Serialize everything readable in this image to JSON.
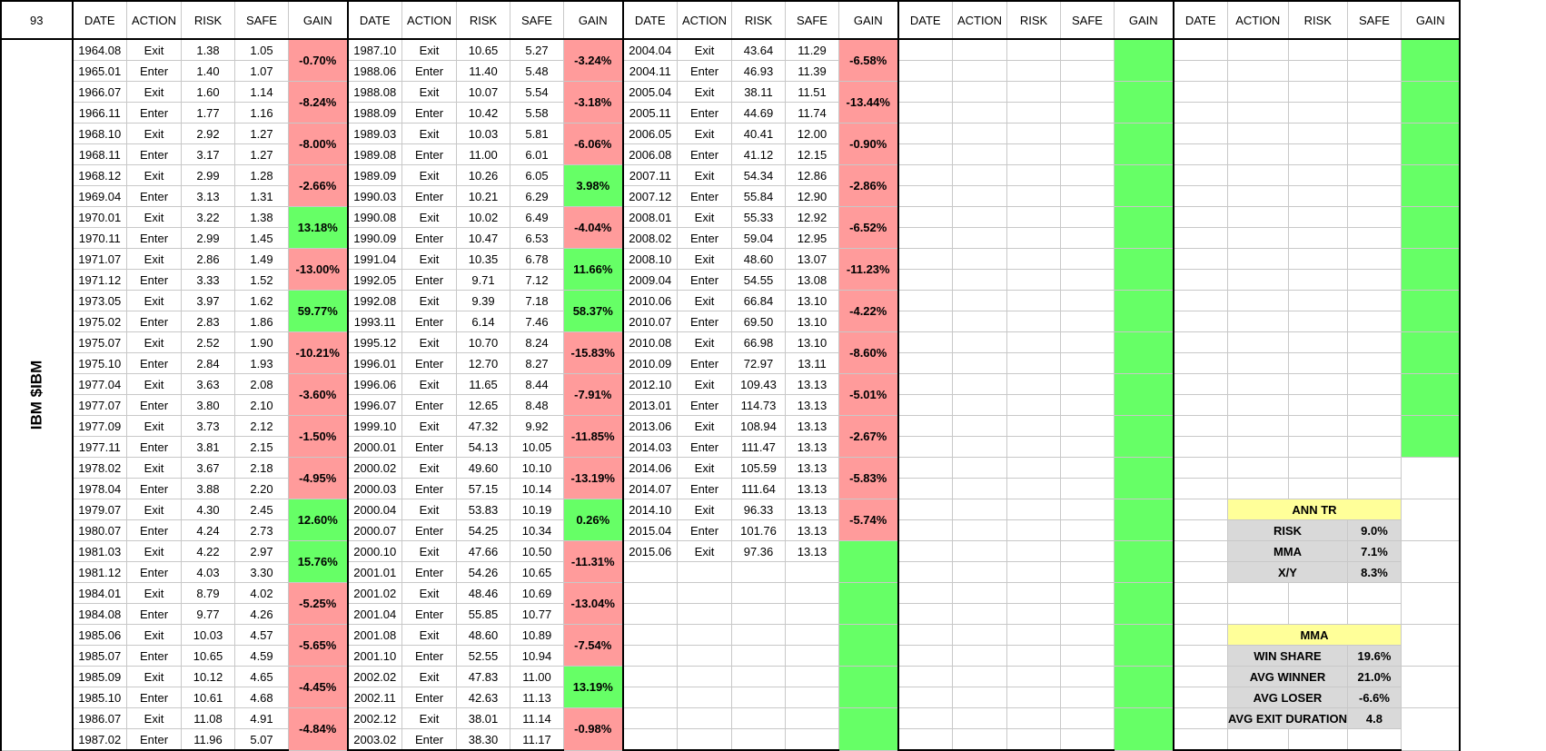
{
  "corner": "93",
  "ticker": "IBM $IBM",
  "headers": [
    "DATE",
    "ACTION",
    "RISK",
    "SAFE",
    "GAIN"
  ],
  "blocks": [
    {
      "rows": [
        [
          "1964.08",
          "Exit",
          "1.38",
          "1.05"
        ],
        [
          "1965.01",
          "Enter",
          "1.40",
          "1.07"
        ],
        [
          "1966.07",
          "Exit",
          "1.60",
          "1.14"
        ],
        [
          "1966.11",
          "Enter",
          "1.77",
          "1.16"
        ],
        [
          "1968.10",
          "Exit",
          "2.92",
          "1.27"
        ],
        [
          "1968.11",
          "Enter",
          "3.17",
          "1.27"
        ],
        [
          "1968.12",
          "Exit",
          "2.99",
          "1.28"
        ],
        [
          "1969.04",
          "Enter",
          "3.13",
          "1.31"
        ],
        [
          "1970.01",
          "Exit",
          "3.22",
          "1.38"
        ],
        [
          "1970.11",
          "Enter",
          "2.99",
          "1.45"
        ],
        [
          "1971.07",
          "Exit",
          "2.86",
          "1.49"
        ],
        [
          "1971.12",
          "Enter",
          "3.33",
          "1.52"
        ],
        [
          "1973.05",
          "Exit",
          "3.97",
          "1.62"
        ],
        [
          "1975.02",
          "Enter",
          "2.83",
          "1.86"
        ],
        [
          "1975.07",
          "Exit",
          "2.52",
          "1.90"
        ],
        [
          "1975.10",
          "Enter",
          "2.84",
          "1.93"
        ],
        [
          "1977.04",
          "Exit",
          "3.63",
          "2.08"
        ],
        [
          "1977.07",
          "Enter",
          "3.80",
          "2.10"
        ],
        [
          "1977.09",
          "Exit",
          "3.73",
          "2.12"
        ],
        [
          "1977.11",
          "Enter",
          "3.81",
          "2.15"
        ],
        [
          "1978.02",
          "Exit",
          "3.67",
          "2.18"
        ],
        [
          "1978.04",
          "Enter",
          "3.88",
          "2.20"
        ],
        [
          "1979.07",
          "Exit",
          "4.30",
          "2.45"
        ],
        [
          "1980.07",
          "Enter",
          "4.24",
          "2.73"
        ],
        [
          "1981.03",
          "Exit",
          "4.22",
          "2.97"
        ],
        [
          "1981.12",
          "Enter",
          "4.03",
          "3.30"
        ],
        [
          "1984.01",
          "Exit",
          "8.79",
          "4.02"
        ],
        [
          "1984.08",
          "Enter",
          "9.77",
          "4.26"
        ],
        [
          "1985.06",
          "Exit",
          "10.03",
          "4.57"
        ],
        [
          "1985.07",
          "Enter",
          "10.65",
          "4.59"
        ],
        [
          "1985.09",
          "Exit",
          "10.12",
          "4.65"
        ],
        [
          "1985.10",
          "Enter",
          "10.61",
          "4.68"
        ],
        [
          "1986.07",
          "Exit",
          "11.08",
          "4.91"
        ],
        [
          "1987.02",
          "Enter",
          "11.96",
          "5.07"
        ]
      ],
      "gains": [
        {
          "v": "-0.70%",
          "c": "red"
        },
        {
          "v": "-8.24%",
          "c": "red"
        },
        {
          "v": "-8.00%",
          "c": "red"
        },
        {
          "v": "-2.66%",
          "c": "red"
        },
        {
          "v": "13.18%",
          "c": "green"
        },
        {
          "v": "-13.00%",
          "c": "red"
        },
        {
          "v": "59.77%",
          "c": "green"
        },
        {
          "v": "-10.21%",
          "c": "red"
        },
        {
          "v": "-3.60%",
          "c": "red"
        },
        {
          "v": "-1.50%",
          "c": "red"
        },
        {
          "v": "-4.95%",
          "c": "red"
        },
        {
          "v": "12.60%",
          "c": "green"
        },
        {
          "v": "15.76%",
          "c": "green"
        },
        {
          "v": "-5.25%",
          "c": "red"
        },
        {
          "v": "-5.65%",
          "c": "red"
        },
        {
          "v": "-4.45%",
          "c": "red"
        },
        {
          "v": "-4.84%",
          "c": "red"
        }
      ]
    },
    {
      "rows": [
        [
          "1987.10",
          "Exit",
          "10.65",
          "5.27"
        ],
        [
          "1988.06",
          "Enter",
          "11.40",
          "5.48"
        ],
        [
          "1988.08",
          "Exit",
          "10.07",
          "5.54"
        ],
        [
          "1988.09",
          "Enter",
          "10.42",
          "5.58"
        ],
        [
          "1989.03",
          "Exit",
          "10.03",
          "5.81"
        ],
        [
          "1989.08",
          "Enter",
          "11.00",
          "6.01"
        ],
        [
          "1989.09",
          "Exit",
          "10.26",
          "6.05"
        ],
        [
          "1990.03",
          "Enter",
          "10.21",
          "6.29"
        ],
        [
          "1990.08",
          "Exit",
          "10.02",
          "6.49"
        ],
        [
          "1990.09",
          "Enter",
          "10.47",
          "6.53"
        ],
        [
          "1991.04",
          "Exit",
          "10.35",
          "6.78"
        ],
        [
          "1992.05",
          "Enter",
          "9.71",
          "7.12"
        ],
        [
          "1992.08",
          "Exit",
          "9.39",
          "7.18"
        ],
        [
          "1993.11",
          "Enter",
          "6.14",
          "7.46"
        ],
        [
          "1995.12",
          "Exit",
          "10.70",
          "8.24"
        ],
        [
          "1996.01",
          "Enter",
          "12.70",
          "8.27"
        ],
        [
          "1996.06",
          "Exit",
          "11.65",
          "8.44"
        ],
        [
          "1996.07",
          "Enter",
          "12.65",
          "8.48"
        ],
        [
          "1999.10",
          "Exit",
          "47.32",
          "9.92"
        ],
        [
          "2000.01",
          "Enter",
          "54.13",
          "10.05"
        ],
        [
          "2000.02",
          "Exit",
          "49.60",
          "10.10"
        ],
        [
          "2000.03",
          "Enter",
          "57.15",
          "10.14"
        ],
        [
          "2000.04",
          "Exit",
          "53.83",
          "10.19"
        ],
        [
          "2000.07",
          "Enter",
          "54.25",
          "10.34"
        ],
        [
          "2000.10",
          "Exit",
          "47.66",
          "10.50"
        ],
        [
          "2001.01",
          "Enter",
          "54.26",
          "10.65"
        ],
        [
          "2001.02",
          "Exit",
          "48.46",
          "10.69"
        ],
        [
          "2001.04",
          "Enter",
          "55.85",
          "10.77"
        ],
        [
          "2001.08",
          "Exit",
          "48.60",
          "10.89"
        ],
        [
          "2001.10",
          "Enter",
          "52.55",
          "10.94"
        ],
        [
          "2002.02",
          "Exit",
          "47.83",
          "11.00"
        ],
        [
          "2002.11",
          "Enter",
          "42.63",
          "11.13"
        ],
        [
          "2002.12",
          "Exit",
          "38.01",
          "11.14"
        ],
        [
          "2003.02",
          "Enter",
          "38.30",
          "11.17"
        ]
      ],
      "gains": [
        {
          "v": "-3.24%",
          "c": "red"
        },
        {
          "v": "-3.18%",
          "c": "red"
        },
        {
          "v": "-6.06%",
          "c": "red"
        },
        {
          "v": "3.98%",
          "c": "green"
        },
        {
          "v": "-4.04%",
          "c": "red"
        },
        {
          "v": "11.66%",
          "c": "green"
        },
        {
          "v": "58.37%",
          "c": "green"
        },
        {
          "v": "-15.83%",
          "c": "red"
        },
        {
          "v": "-7.91%",
          "c": "red"
        },
        {
          "v": "-11.85%",
          "c": "red"
        },
        {
          "v": "-13.19%",
          "c": "red"
        },
        {
          "v": "0.26%",
          "c": "green"
        },
        {
          "v": "-11.31%",
          "c": "red"
        },
        {
          "v": "-13.04%",
          "c": "red"
        },
        {
          "v": "-7.54%",
          "c": "red"
        },
        {
          "v": "13.19%",
          "c": "green"
        },
        {
          "v": "-0.98%",
          "c": "red"
        }
      ]
    },
    {
      "rows": [
        [
          "2004.04",
          "Exit",
          "43.64",
          "11.29"
        ],
        [
          "2004.11",
          "Enter",
          "46.93",
          "11.39"
        ],
        [
          "2005.04",
          "Exit",
          "38.11",
          "11.51"
        ],
        [
          "2005.11",
          "Enter",
          "44.69",
          "11.74"
        ],
        [
          "2006.05",
          "Exit",
          "40.41",
          "12.00"
        ],
        [
          "2006.08",
          "Enter",
          "41.12",
          "12.15"
        ],
        [
          "2007.11",
          "Exit",
          "54.34",
          "12.86"
        ],
        [
          "2007.12",
          "Enter",
          "55.84",
          "12.90"
        ],
        [
          "2008.01",
          "Exit",
          "55.33",
          "12.92"
        ],
        [
          "2008.02",
          "Enter",
          "59.04",
          "12.95"
        ],
        [
          "2008.10",
          "Exit",
          "48.60",
          "13.07"
        ],
        [
          "2009.04",
          "Enter",
          "54.55",
          "13.08"
        ],
        [
          "2010.06",
          "Exit",
          "66.84",
          "13.10"
        ],
        [
          "2010.07",
          "Enter",
          "69.50",
          "13.10"
        ],
        [
          "2010.08",
          "Exit",
          "66.98",
          "13.10"
        ],
        [
          "2010.09",
          "Enter",
          "72.97",
          "13.11"
        ],
        [
          "2012.10",
          "Exit",
          "109.43",
          "13.13"
        ],
        [
          "2013.01",
          "Enter",
          "114.73",
          "13.13"
        ],
        [
          "2013.06",
          "Exit",
          "108.94",
          "13.13"
        ],
        [
          "2014.03",
          "Enter",
          "111.47",
          "13.13"
        ],
        [
          "2014.06",
          "Exit",
          "105.59",
          "13.13"
        ],
        [
          "2014.07",
          "Enter",
          "111.64",
          "13.13"
        ],
        [
          "2014.10",
          "Exit",
          "96.33",
          "13.13"
        ],
        [
          "2015.04",
          "Enter",
          "101.76",
          "13.13"
        ],
        [
          "2015.06",
          "Exit",
          "97.36",
          "13.13"
        ]
      ],
      "gains": [
        {
          "v": "-6.58%",
          "c": "red"
        },
        {
          "v": "-13.44%",
          "c": "red"
        },
        {
          "v": "-0.90%",
          "c": "red"
        },
        {
          "v": "-2.86%",
          "c": "red"
        },
        {
          "v": "-6.52%",
          "c": "red"
        },
        {
          "v": "-11.23%",
          "c": "red"
        },
        {
          "v": "-4.22%",
          "c": "red"
        },
        {
          "v": "-8.60%",
          "c": "red"
        },
        {
          "v": "-5.01%",
          "c": "red"
        },
        {
          "v": "-2.67%",
          "c": "red"
        },
        {
          "v": "-5.83%",
          "c": "red"
        },
        {
          "v": "-5.74%",
          "c": "red"
        },
        {
          "v": "",
          "c": "green"
        },
        {
          "v": "",
          "c": "green"
        },
        {
          "v": "",
          "c": "green"
        },
        {
          "v": "",
          "c": "green"
        },
        {
          "v": "",
          "c": "green"
        }
      ]
    },
    {
      "rows": [],
      "gains": [
        {
          "v": "",
          "c": "green"
        },
        {
          "v": "",
          "c": "green"
        },
        {
          "v": "",
          "c": "green"
        },
        {
          "v": "",
          "c": "green"
        },
        {
          "v": "",
          "c": "green"
        },
        {
          "v": "",
          "c": "green"
        },
        {
          "v": "",
          "c": "green"
        },
        {
          "v": "",
          "c": "green"
        },
        {
          "v": "",
          "c": "green"
        },
        {
          "v": "",
          "c": "green"
        },
        {
          "v": "",
          "c": "green"
        },
        {
          "v": "",
          "c": "green"
        },
        {
          "v": "",
          "c": "green"
        },
        {
          "v": "",
          "c": "green"
        },
        {
          "v": "",
          "c": "green"
        },
        {
          "v": "",
          "c": "green"
        },
        {
          "v": "",
          "c": "green"
        }
      ]
    },
    {
      "rows": [],
      "gains": [
        {
          "v": "",
          "c": "green"
        },
        {
          "v": "",
          "c": "green"
        },
        {
          "v": "",
          "c": "green"
        },
        {
          "v": "",
          "c": "green"
        },
        {
          "v": "",
          "c": "green"
        },
        {
          "v": "",
          "c": "green"
        },
        {
          "v": "",
          "c": "green"
        },
        {
          "v": "",
          "c": "green"
        },
        {
          "v": "",
          "c": "green"
        },
        {
          "v": "",
          "c": "green"
        },
        {
          "v": "",
          "c": "none"
        },
        {
          "v": "",
          "c": "none"
        },
        {
          "v": "",
          "c": "none"
        },
        {
          "v": "",
          "c": "none"
        },
        {
          "v": "",
          "c": "none"
        },
        {
          "v": "",
          "c": "none"
        },
        {
          "v": "",
          "c": "none"
        }
      ]
    }
  ],
  "stats": {
    "ann_tr": {
      "title": "ANN TR",
      "rows": [
        {
          "label": "RISK",
          "value": "9.0%"
        },
        {
          "label": "MMA",
          "value": "7.1%"
        },
        {
          "label": "X/Y",
          "value": "8.3%"
        }
      ]
    },
    "mma": {
      "title": "MMA",
      "rows": [
        {
          "label": "WIN SHARE",
          "value": "19.6%"
        },
        {
          "label": "AVG WINNER",
          "value": "21.0%"
        },
        {
          "label": "AVG LOSER",
          "value": "-6.6%"
        },
        {
          "label": "AVG EXIT DURATION",
          "value": "4.8"
        }
      ]
    }
  },
  "colors": {
    "loss_fill": "#ff9b9b",
    "gain_fill": "#66ff66",
    "stat_title_fill": "#ffff99",
    "stat_body_fill": "#d9d9d9",
    "grid_line": "#c8c8c8"
  }
}
